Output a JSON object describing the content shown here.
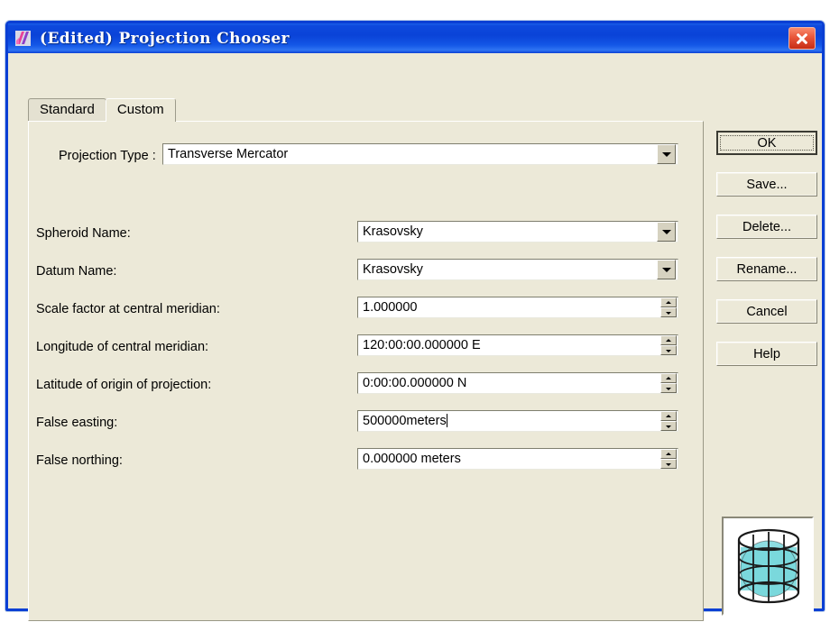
{
  "window": {
    "title": "(Edited) Projection Chooser",
    "app_icon": "app-icon",
    "close_label": "x"
  },
  "tabs": [
    {
      "label": "Standard",
      "active": false
    },
    {
      "label": "Custom",
      "active": true
    }
  ],
  "form": {
    "projection_type": {
      "label": "Projection Type :",
      "value": "Transverse Mercator",
      "control": "combobox"
    },
    "fields": [
      {
        "label": "Spheroid Name:",
        "value": "Krasovsky",
        "control": "combobox"
      },
      {
        "label": "Datum Name:",
        "value": "Krasovsky",
        "control": "combobox"
      },
      {
        "label": "Scale factor at central meridian:",
        "value": "1.000000",
        "control": "spinner"
      },
      {
        "label": "Longitude of central meridian:",
        "value": "120:00:00.000000 E",
        "control": "spinner"
      },
      {
        "label": "Latitude of origin of projection:",
        "value": "0:00:00.000000 N",
        "control": "spinner"
      },
      {
        "label": "False easting:",
        "value": "500000meters",
        "control": "spinner",
        "focused": true
      },
      {
        "label": "False northing:",
        "value": "0.000000 meters",
        "control": "spinner"
      }
    ]
  },
  "buttons": [
    {
      "label": "OK",
      "default": true
    },
    {
      "label": "Save...",
      "default": false
    },
    {
      "label": "Delete...",
      "default": false
    },
    {
      "label": "Rename...",
      "default": false
    },
    {
      "label": "Cancel",
      "default": false
    },
    {
      "label": "Help",
      "default": false
    }
  ],
  "illustration": {
    "name": "cylindrical-projection-icon",
    "sphere_color": "#7ad8dc",
    "wire_color": "#1a1a1a"
  },
  "colors": {
    "titlebar_blue": "#0a43d8",
    "dialog_face": "#ece9d8",
    "close_red": "#c62d16",
    "field_white": "#ffffff"
  }
}
